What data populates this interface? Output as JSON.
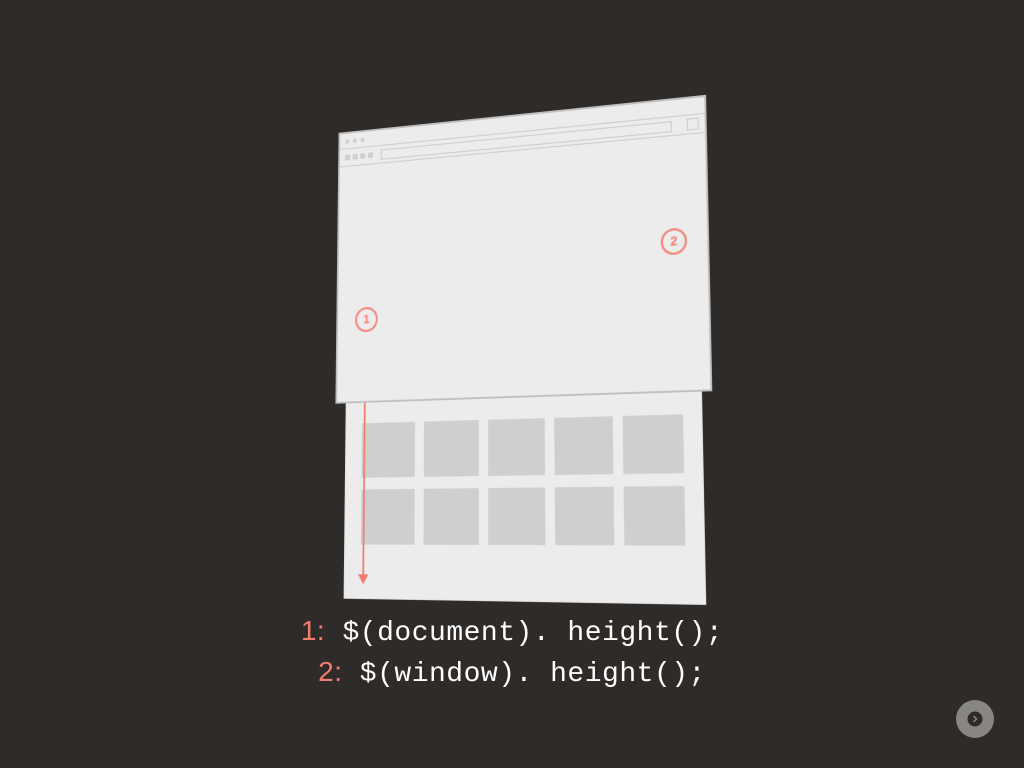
{
  "badges": {
    "one": "1",
    "two": "2"
  },
  "caption": {
    "line1_num": "1:",
    "line1_code": "$(document). height();",
    "line2_num": "2:",
    "line2_code": "$(window). height();"
  },
  "colors": {
    "accent": "#f37d6f",
    "background": "#2e2b29",
    "ui_gray": "#cfcfcf"
  }
}
